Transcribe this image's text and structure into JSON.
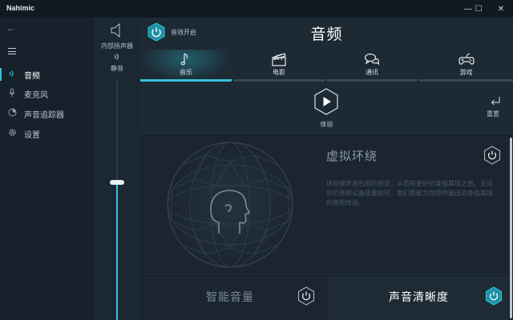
{
  "window": {
    "title": "Nahimic",
    "controls": {
      "minimize": "—",
      "maximize": "☐",
      "close": "✕"
    }
  },
  "sidebar": {
    "back_icon": "←",
    "menu_icon": "hamburger-icon",
    "items": [
      {
        "label": "音频",
        "icon": "audio-wave-icon",
        "active": true
      },
      {
        "label": "麦克风",
        "icon": "microphone-icon",
        "active": false
      },
      {
        "label": "声音追踪器",
        "icon": "sound-tracker-icon",
        "active": false
      },
      {
        "label": "设置",
        "icon": "gear-icon",
        "active": false
      }
    ]
  },
  "volume": {
    "device_label": "内部扬声器",
    "mute_label": "静音",
    "level": 0.5
  },
  "header": {
    "effects_label": "音效开启",
    "title": "音频"
  },
  "tabs": [
    {
      "label": "音乐",
      "icon": "music-note-icon",
      "active": true
    },
    {
      "label": "电影",
      "icon": "clapperboard-icon",
      "active": false
    },
    {
      "label": "通讯",
      "icon": "chat-bubbles-icon",
      "active": false
    },
    {
      "label": "游戏",
      "icon": "gamepad-icon",
      "active": false
    }
  ],
  "experience": {
    "label": "体验"
  },
  "reset": {
    "label": "重置"
  },
  "virtual_surround": {
    "title": "虚拟环绕",
    "description": "体验被声音包围的感觉，从而有更好的身临其境之感。无论您的音频设备质量如何，我们都能为您提供最佳的身临其境的音频体验。",
    "enabled": false
  },
  "smart_volume": {
    "title": "智能音量",
    "enabled": false
  },
  "voice_clarity": {
    "title": "声音清晰度",
    "enabled": true
  },
  "colors": {
    "accent": "#2fc4d9",
    "background": "#1d2933",
    "sidebar": "#16212b"
  }
}
